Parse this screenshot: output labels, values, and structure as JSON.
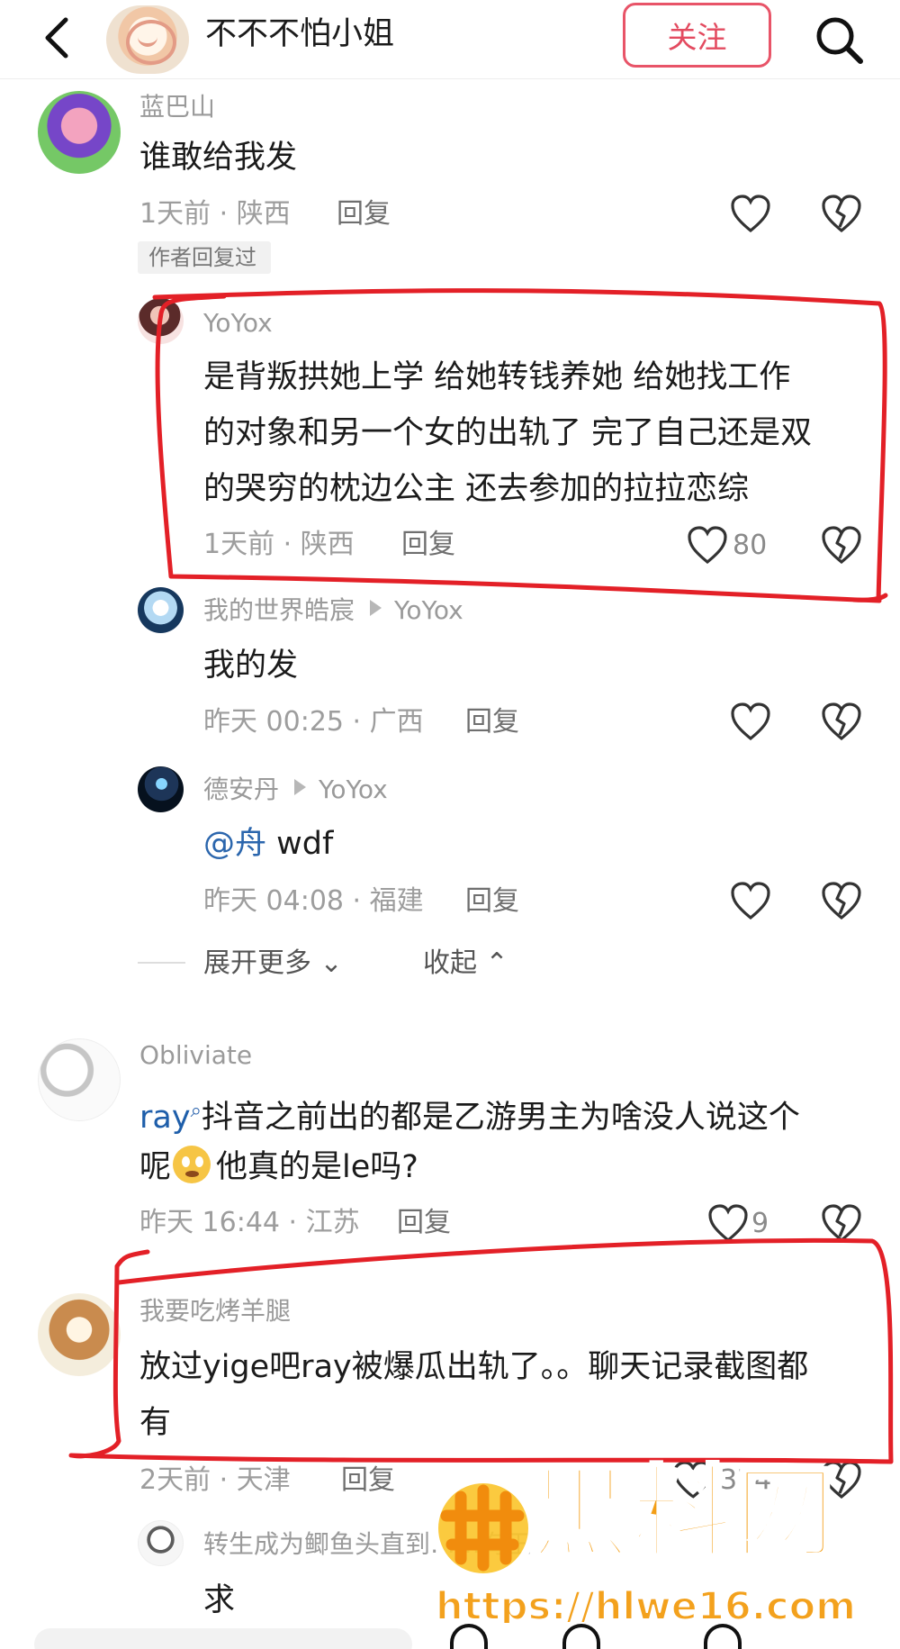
{
  "header": {
    "title": "不不不怕小姐",
    "follow_label": "关注"
  },
  "comments": [
    {
      "username": "蓝巴山",
      "text": "谁敢给我发",
      "meta": "1天前 · 陕西",
      "reply_label": "回复",
      "badge": "作者回复过"
    },
    {
      "username": "YoYox",
      "text_lines": [
        "是背叛拱她上学 给她转钱养她 给她找工作",
        "的对象和另一个女的出轨了 完了自己还是双",
        "的哭穷的枕边公主 还去参加的拉拉恋综"
      ],
      "meta": "1天前 · 陕西",
      "reply_label": "回复",
      "likes": "80"
    },
    {
      "username": "我的世界皓宸",
      "reply_to": "YoYox",
      "text": "我的发",
      "meta": "昨天 00:25 · 广西",
      "reply_label": "回复"
    },
    {
      "username": "德安丹",
      "reply_to": "YoYox",
      "mention": "@舟",
      "text": " wdf",
      "meta": "昨天 04:08 · 福建",
      "reply_label": "回复"
    },
    {
      "username": "Obliviate",
      "mention": "ray",
      "text_line1": "抖音之前出的都是乙游男主为啥没人说这个",
      "text_line2_before": "呢",
      "text_line2_after": "他真的是le吗?",
      "meta": "昨天 16:44 · 江苏",
      "reply_label": "回复",
      "likes": "9"
    },
    {
      "username": "我要吃烤羊腿",
      "text_lines": [
        "放过yige吧ray被爆瓜出轨了。。聊天记录截图都",
        "有"
      ],
      "meta": "2天前 · 天津",
      "reply_label": "回复",
      "likes": "374"
    },
    {
      "username": "转生成为鲫鱼头直到……海王",
      "text": "求"
    }
  ],
  "thread": {
    "expand_label": "展开更多",
    "collapse_label": "收起"
  },
  "watermark": {
    "brand": "黑料网",
    "url": "https://hlwe16.com"
  },
  "colors": {
    "follow": "#e34b60",
    "annotation": "#e32027",
    "watermark": "#f39e16"
  },
  "icons": [
    "back-icon",
    "search-icon",
    "heart-icon",
    "broken-heart-icon"
  ]
}
